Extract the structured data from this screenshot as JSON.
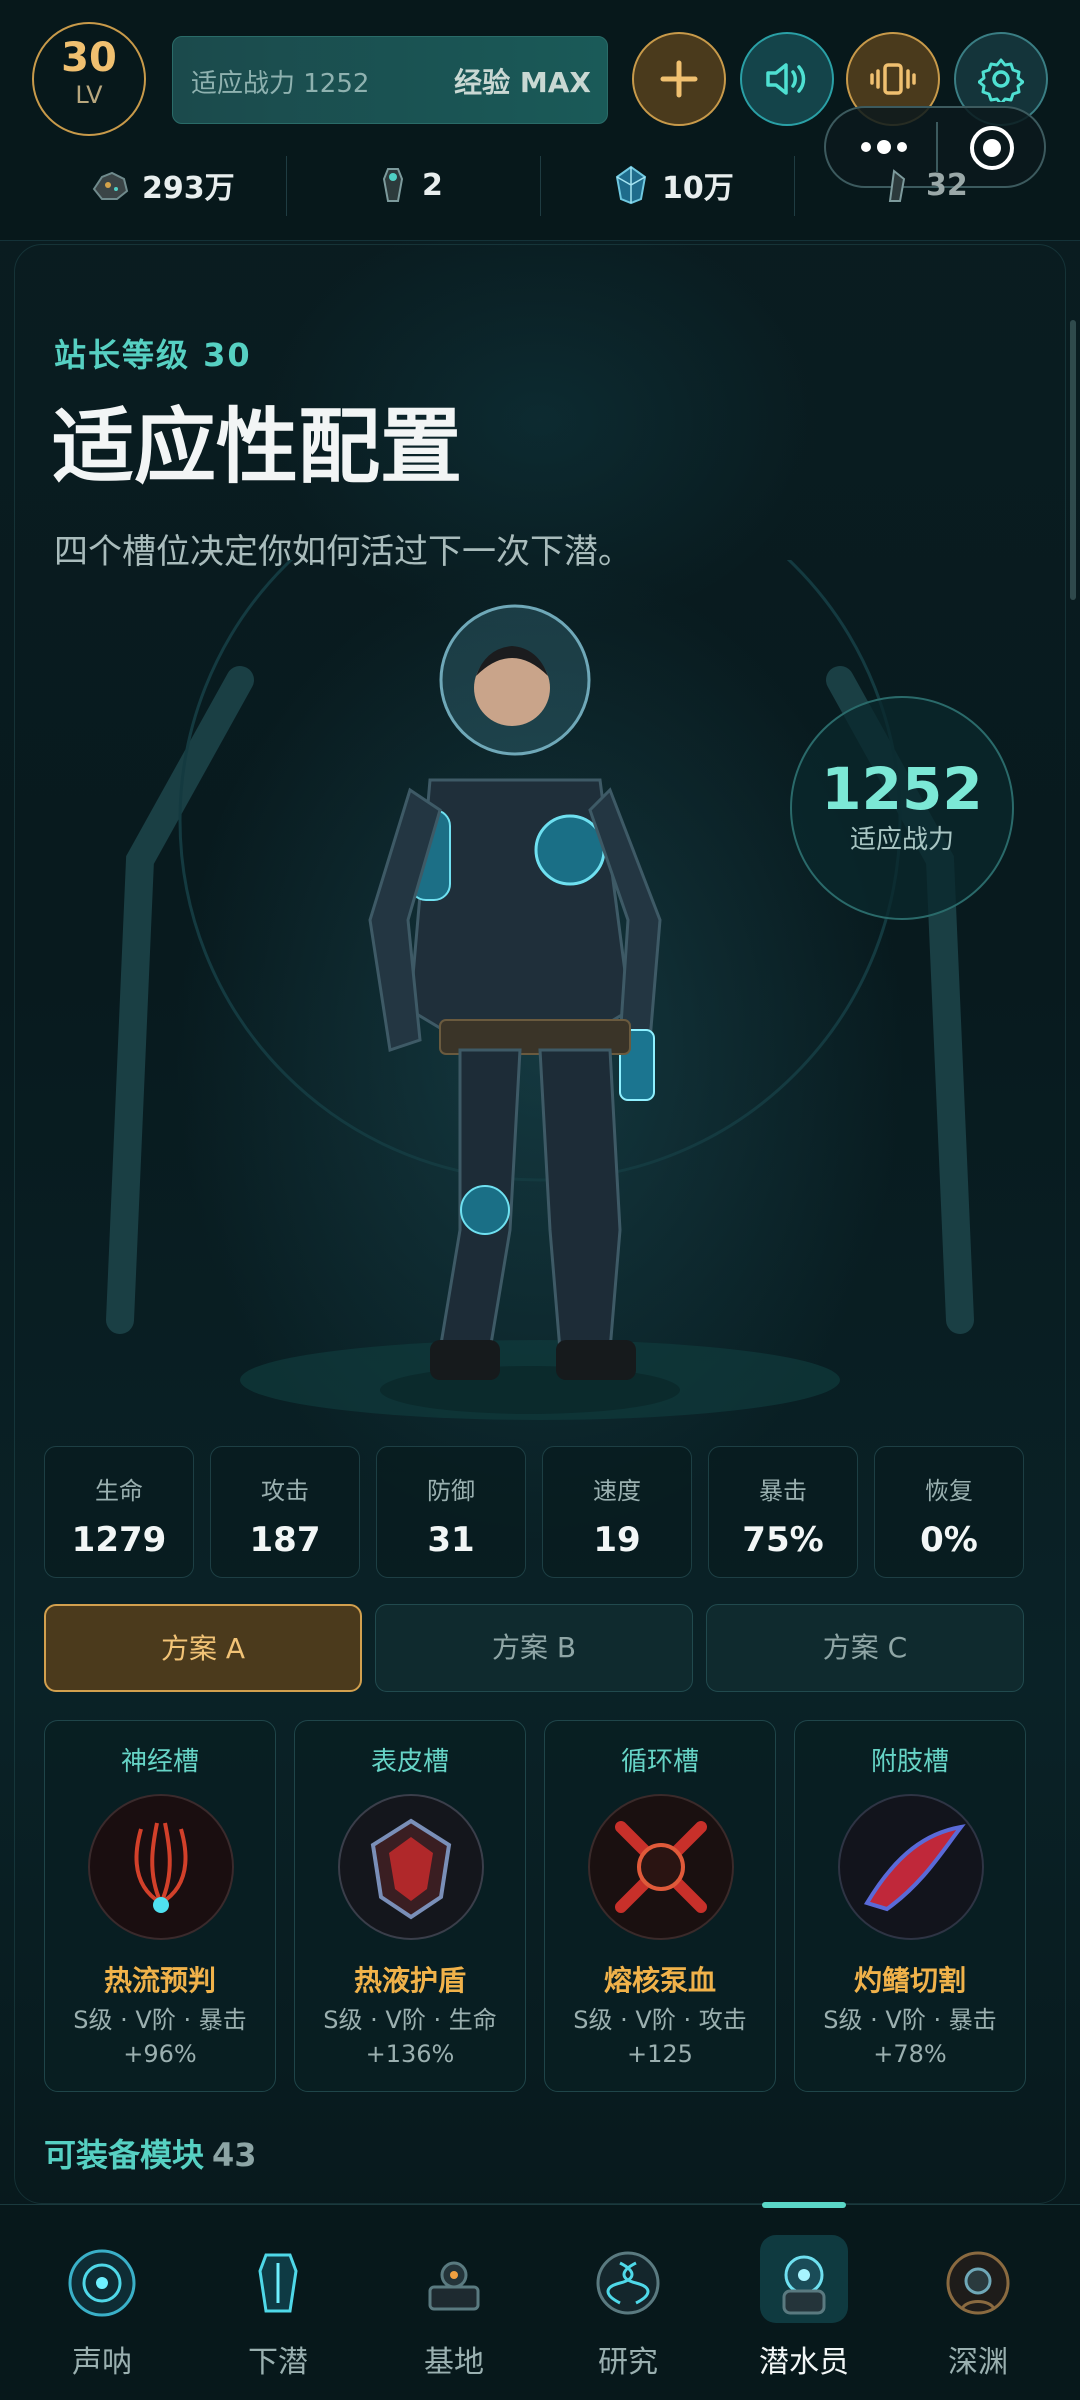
{
  "top": {
    "level_number": "30",
    "level_label": "LV",
    "power_placeholder": "适应战力 1252",
    "exp_label": "经验 MAX"
  },
  "resources": [
    {
      "icon": "ore-icon",
      "value": "293万"
    },
    {
      "icon": "diver-token-icon",
      "value": "2"
    },
    {
      "icon": "crystal-icon",
      "value": "10万"
    },
    {
      "icon": "fin-token-icon",
      "value": "32"
    }
  ],
  "hero": {
    "station_level": "站长等级 30",
    "title": "适应性配置",
    "subtitle": "四个槽位决定你如何活过下一次下潜。",
    "power_value": "1252",
    "power_label": "适应战力"
  },
  "stats": [
    {
      "label": "生命",
      "value": "1279"
    },
    {
      "label": "攻击",
      "value": "187"
    },
    {
      "label": "防御",
      "value": "31"
    },
    {
      "label": "速度",
      "value": "19"
    },
    {
      "label": "暴击",
      "value": "75%"
    },
    {
      "label": "恢复",
      "value": "0%"
    }
  ],
  "plans": [
    "方案 A",
    "方案 B",
    "方案 C"
  ],
  "active_plan": "方案 A",
  "slots": [
    {
      "slot": "神经槽",
      "module": "热流预判",
      "desc1": "S级 · V阶 · 暴击",
      "desc2": "+96%"
    },
    {
      "slot": "表皮槽",
      "module": "热液护盾",
      "desc1": "S级 · V阶 · 生命",
      "desc2": "+136%"
    },
    {
      "slot": "循环槽",
      "module": "熔核泵血",
      "desc1": "S级 · V阶 · 攻击",
      "desc2": "+125"
    },
    {
      "slot": "附肢槽",
      "module": "灼鳍切割",
      "desc1": "S级 · V阶 · 暴击",
      "desc2": "+78%"
    }
  ],
  "equip": {
    "label": "可装备模块",
    "count": "43"
  },
  "nav": [
    {
      "label": "声呐",
      "icon": "sonar-icon"
    },
    {
      "label": "下潜",
      "icon": "dive-icon"
    },
    {
      "label": "基地",
      "icon": "base-icon"
    },
    {
      "label": "研究",
      "icon": "research-icon"
    },
    {
      "label": "潜水员",
      "icon": "diver-icon"
    },
    {
      "label": "深渊",
      "icon": "abyss-icon"
    }
  ],
  "colors": {
    "accent": "#56d0c2",
    "gold": "#f0b24a",
    "bg": "#081a1e"
  }
}
